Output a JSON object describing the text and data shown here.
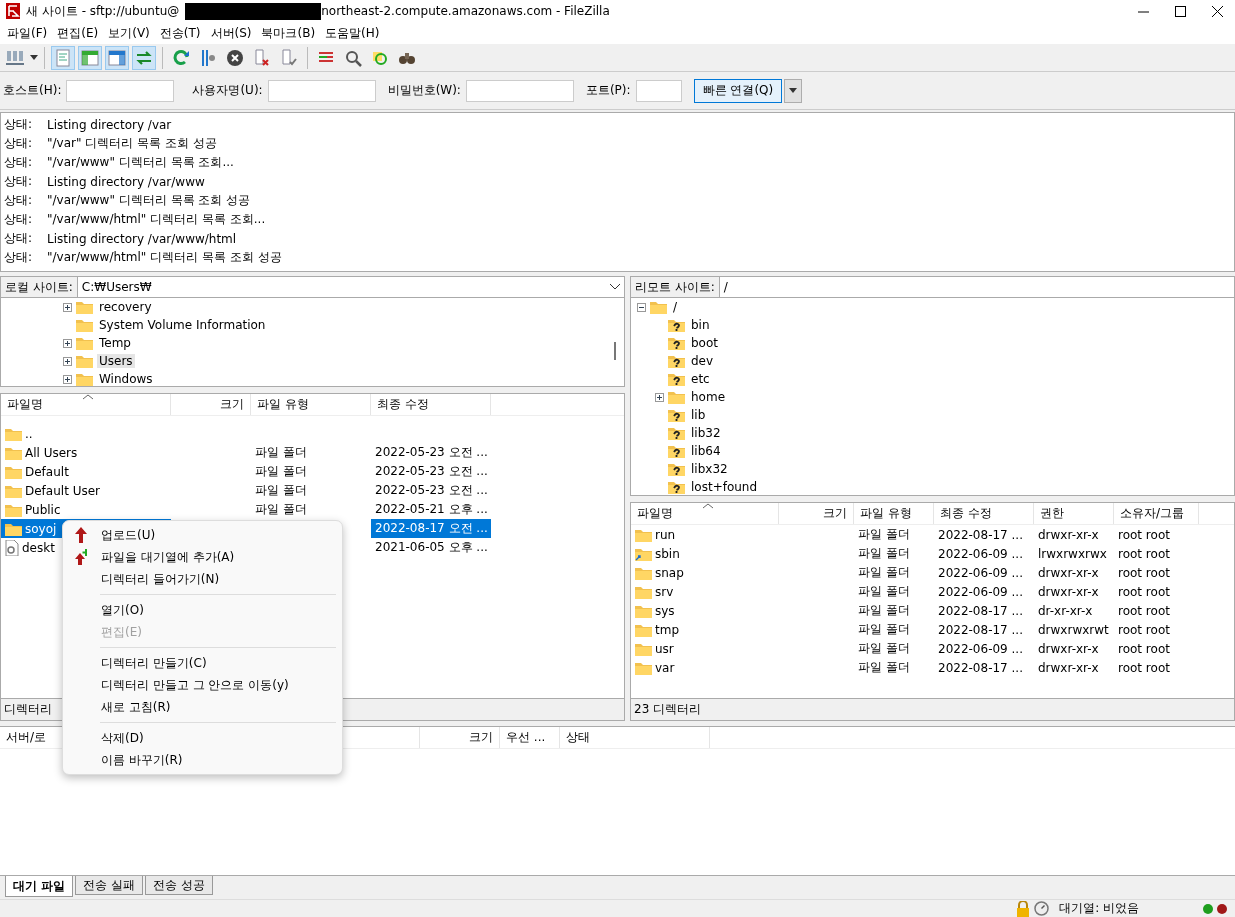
{
  "window": {
    "title_start": "새 사이트 - sftp://ubuntu@",
    "title_end": "northeast-2.compute.amazonaws.com - FileZilla"
  },
  "menu": [
    "파일(F)",
    "편집(E)",
    "보기(V)",
    "전송(T)",
    "서버(S)",
    "북마크(B)",
    "도움말(H)"
  ],
  "view_toggles": [
    {
      "on": true
    },
    {
      "on": true
    },
    {
      "on": true
    },
    {
      "on": true
    }
  ],
  "quickconnect": {
    "host_label": "호스트(H):",
    "user_label": "사용자명(U):",
    "pass_label": "비밀번호(W):",
    "port_label": "포트(P):",
    "button": "빠른 연결(Q)"
  },
  "log": [
    {
      "label": "상태:",
      "message": "Listing directory /var"
    },
    {
      "label": "상태:",
      "message": "\"/var\" 디렉터리 목록 조회 성공"
    },
    {
      "label": "상태:",
      "message": "\"/var/www\" 디렉터리 목록 조회..."
    },
    {
      "label": "상태:",
      "message": "Listing directory /var/www"
    },
    {
      "label": "상태:",
      "message": "\"/var/www\" 디렉터리 목록 조회 성공"
    },
    {
      "label": "상태:",
      "message": "\"/var/www/html\" 디렉터리 목록 조회..."
    },
    {
      "label": "상태:",
      "message": "Listing directory /var/www/html"
    },
    {
      "label": "상태:",
      "message": "\"/var/www/html\" 디렉터리 목록 조회 성공"
    }
  ],
  "local": {
    "site_label": "로컬 사이트:",
    "path": "C:₩Users₩",
    "tree": [
      {
        "name": "recovery",
        "expandable": true,
        "selected": false
      },
      {
        "name": "System Volume Information",
        "expandable": false,
        "selected": false
      },
      {
        "name": "Temp",
        "expandable": true,
        "selected": false
      },
      {
        "name": "Users",
        "expandable": true,
        "selected": true
      },
      {
        "name": "Windows",
        "expandable": true,
        "selected": false
      }
    ],
    "columns": [
      "파일명",
      "크기",
      "파일 유형",
      "최종 수정"
    ],
    "rows": [
      {
        "kind": "folder",
        "selected": false,
        "name": ".."
      },
      {
        "kind": "folder",
        "selected": false,
        "name": "All Users",
        "type": "파일 폴더",
        "modified": "2022-05-23 오전 ..."
      },
      {
        "kind": "folder",
        "selected": false,
        "name": "Default",
        "type": "파일 폴더",
        "modified": "2022-05-23 오전 ..."
      },
      {
        "kind": "folder",
        "selected": false,
        "name": "Default User",
        "type": "파일 폴더",
        "modified": "2022-05-23 오전 ..."
      },
      {
        "kind": "folder",
        "selected": false,
        "name": "Public",
        "type": "파일 폴더",
        "modified": "2022-05-21 오후 ..."
      },
      {
        "kind": "folder",
        "selected": true,
        "name": "soyoj",
        "modified": "2022-08-17 오전 ..."
      },
      {
        "kind": "file",
        "selected": false,
        "name": "deskt",
        "modified": "2021-06-05 오후 ..."
      }
    ],
    "status": "디렉터리"
  },
  "remote": {
    "site_label": "리모트 사이트:",
    "path": "/",
    "tree": [
      {
        "name": "/",
        "kind": "folder",
        "expanded": true,
        "children": [
          {
            "name": "bin",
            "kind": "unknown"
          },
          {
            "name": "boot",
            "kind": "unknown"
          },
          {
            "name": "dev",
            "kind": "unknown"
          },
          {
            "name": "etc",
            "kind": "unknown"
          },
          {
            "name": "home",
            "kind": "folder",
            "expanded": false
          },
          {
            "name": "lib",
            "kind": "unknown"
          },
          {
            "name": "lib32",
            "kind": "unknown"
          },
          {
            "name": "lib64",
            "kind": "unknown"
          },
          {
            "name": "libx32",
            "kind": "unknown"
          },
          {
            "name": "lost+found",
            "kind": "unknown"
          }
        ]
      }
    ],
    "columns": [
      "파일명",
      "크기",
      "파일 유형",
      "최종 수정",
      "권한",
      "소유자/그룹"
    ],
    "rows": [
      {
        "kind": "folder",
        "name": "run",
        "type": "파일 폴더",
        "modified": "2022-08-17 ...",
        "perms": "drwxr-xr-x",
        "owner": "root root"
      },
      {
        "kind": "link",
        "name": "sbin",
        "type": "파일 폴더",
        "modified": "2022-06-09 ...",
        "perms": "lrwxrwxrwx",
        "owner": "root root"
      },
      {
        "kind": "folder",
        "name": "snap",
        "type": "파일 폴더",
        "modified": "2022-06-09 ...",
        "perms": "drwxr-xr-x",
        "owner": "root root"
      },
      {
        "kind": "folder",
        "name": "srv",
        "type": "파일 폴더",
        "modified": "2022-06-09 ...",
        "perms": "drwxr-xr-x",
        "owner": "root root"
      },
      {
        "kind": "folder",
        "name": "sys",
        "type": "파일 폴더",
        "modified": "2022-08-17 ...",
        "perms": "dr-xr-xr-x",
        "owner": "root root"
      },
      {
        "kind": "folder",
        "name": "tmp",
        "type": "파일 폴더",
        "modified": "2022-08-17 ...",
        "perms": "drwxrwxrwt",
        "owner": "root root"
      },
      {
        "kind": "folder",
        "name": "usr",
        "type": "파일 폴더",
        "modified": "2022-06-09 ...",
        "perms": "drwxr-xr-x",
        "owner": "root root"
      },
      {
        "kind": "folder",
        "name": "var",
        "type": "파일 폴더",
        "modified": "2022-08-17 ...",
        "perms": "drwxr-xr-x",
        "owner": "root root"
      }
    ],
    "status": "23 디렉터리"
  },
  "queue": {
    "columns": [
      "서버/로",
      "크기",
      "우선 ...",
      "상태"
    ]
  },
  "queue_tabs": [
    {
      "label": "대기 파일",
      "selected": true
    },
    {
      "label": "전송 실패",
      "selected": false
    },
    {
      "label": "전송 성공",
      "selected": false
    }
  ],
  "status_bar": {
    "queue": "대기열: 비었음",
    "lights": [
      {
        "color": "#1e9e1e"
      },
      {
        "color": "#a01818"
      }
    ]
  },
  "context_menu": [
    {
      "kind": "upload",
      "label": "업로드(U)",
      "disabled": false
    },
    {
      "kind": "queue-add",
      "label": "파일을 대기열에 추가(A)",
      "disabled": false
    },
    {
      "kind": "item",
      "label": "디렉터리 들어가기(N)",
      "disabled": false
    },
    {
      "kind": "separator"
    },
    {
      "kind": "item",
      "label": "열기(O)",
      "disabled": false
    },
    {
      "kind": "item",
      "label": "편집(E)",
      "disabled": true
    },
    {
      "kind": "separator"
    },
    {
      "kind": "item",
      "label": "디렉터리 만들기(C)",
      "disabled": false
    },
    {
      "kind": "item",
      "label": "디렉터리 만들고 그 안으로 이동(y)",
      "disabled": false
    },
    {
      "kind": "item",
      "label": "새로 고침(R)",
      "disabled": false
    },
    {
      "kind": "separator"
    },
    {
      "kind": "item",
      "label": "삭제(D)",
      "disabled": false
    },
    {
      "kind": "item",
      "label": "이름 바꾸기(R)",
      "disabled": false
    }
  ]
}
